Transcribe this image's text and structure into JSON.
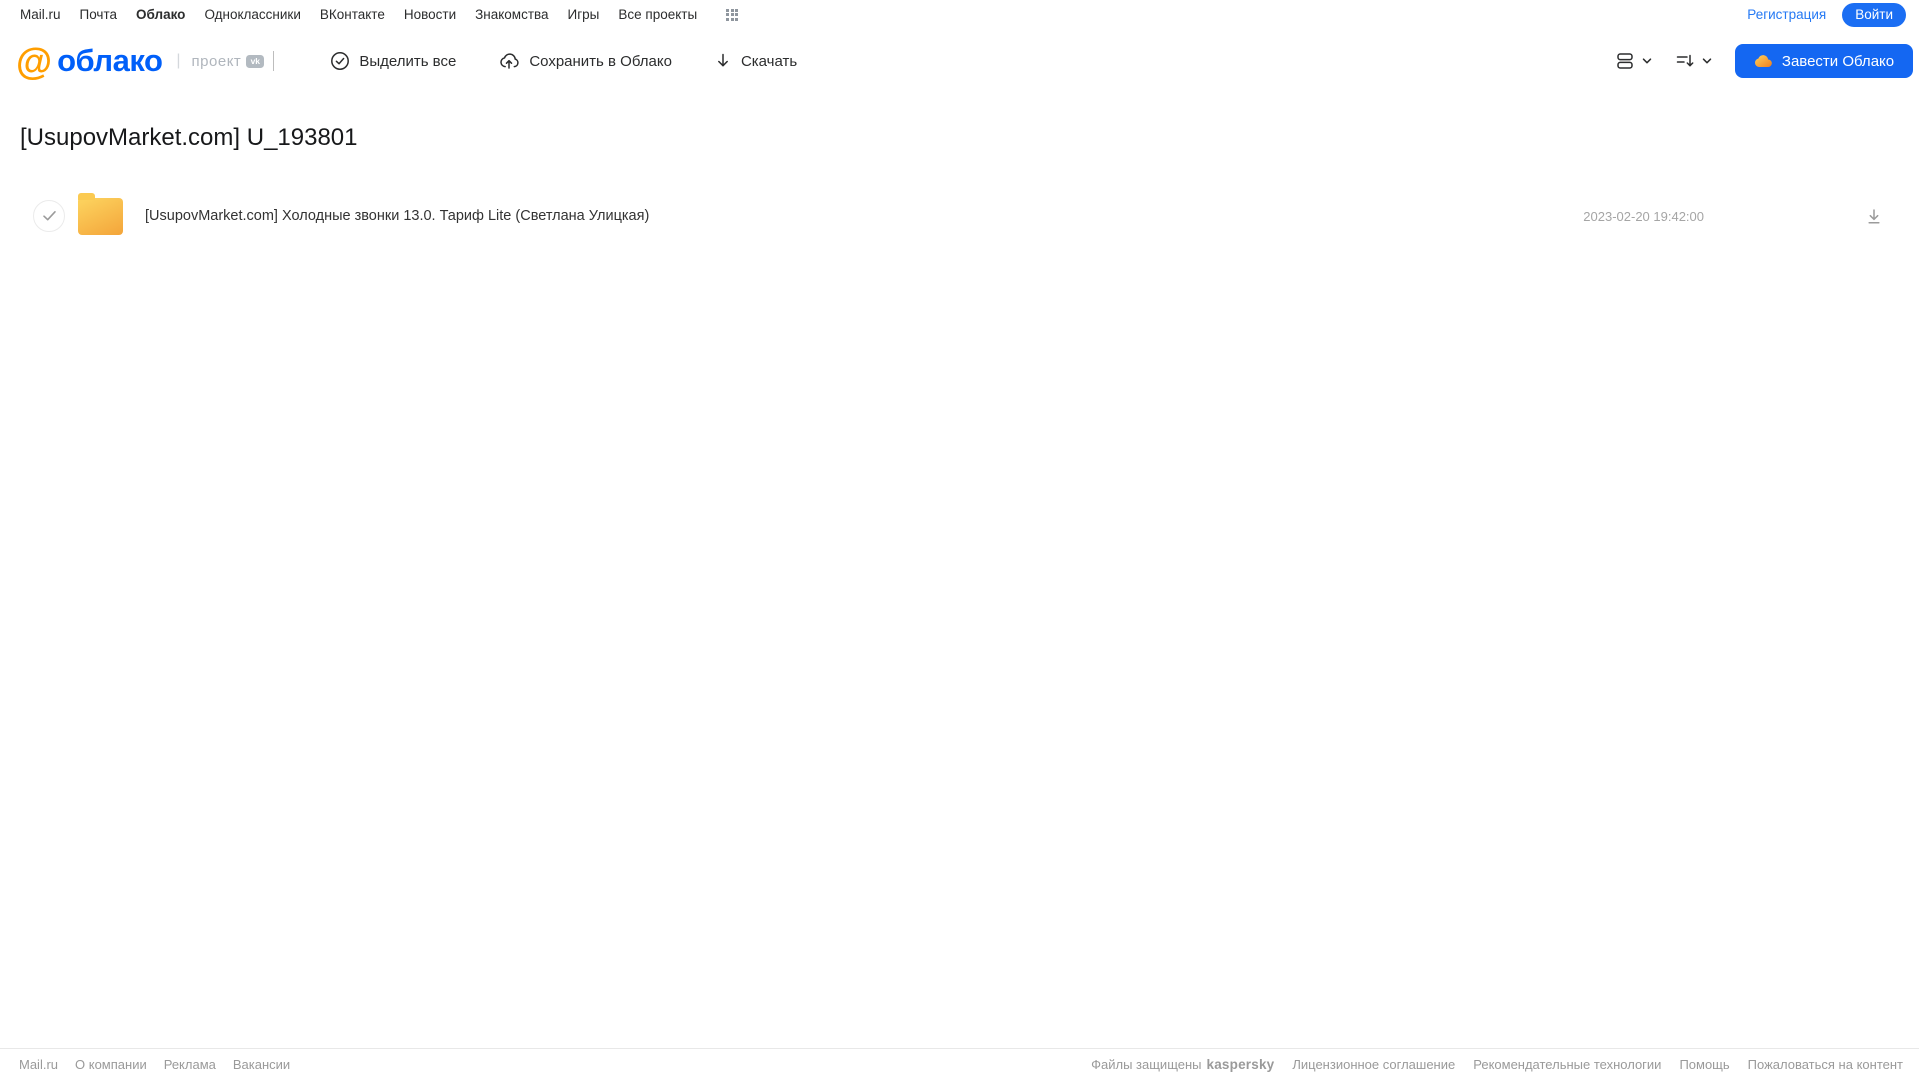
{
  "portal_nav": {
    "items": [
      "Mail.ru",
      "Почта",
      "Облако",
      "Одноклассники",
      "ВКонтакте",
      "Новости",
      "Знакомства",
      "Игры",
      "Все проекты"
    ],
    "active_item": "Облако",
    "registration_label": "Регистрация",
    "login_label": "Войти"
  },
  "header": {
    "logo_at": "@",
    "logo_text": "облако",
    "logo_separator": "|",
    "project_label": "проект",
    "vk_badge": "vk",
    "toolbar": {
      "select_all_label": "Выделить все",
      "save_to_cloud_label": "Сохранить в Облако",
      "download_label": "Скачать"
    },
    "get_cloud_button_label": "Завести Облако"
  },
  "page": {
    "title": "[UsupovMarket.com] U_193801"
  },
  "files": [
    {
      "type": "folder",
      "name": "[UsupovMarket.com] Холодные звонки 13.0. Тариф Lite (Светлана Улицкая)",
      "date": "2023-02-20 19:42:00"
    }
  ],
  "footer": {
    "left_links": [
      "Mail.ru",
      "О компании",
      "Реклама",
      "Вакансии"
    ],
    "protected_by_label": "Файлы защищены",
    "kaspersky_label": "kaspersky",
    "right_links": [
      "Лицензионное соглашение",
      "Рекомендательные технологии",
      "Помощь",
      "Пожаловаться на контент"
    ]
  },
  "icons": {
    "apps_grid": "3x3-grid",
    "select_all": "check-circle",
    "save_to_cloud": "cloud-upload-arrow",
    "download": "arrow-down",
    "view_mode": "list-rows",
    "sort": "lines-with-down-arrow",
    "chevron": "chevron-down",
    "cloud_button": "orange-cloud",
    "row_download": "arrow-down-tray",
    "row_checkbox": "checkmark"
  },
  "colors": {
    "accent_blue": "#1b6ef3",
    "logo_orange": "#ff9e00",
    "logo_blue": "#005ff9",
    "kaspersky_green": "#00846c",
    "folder_top": "#fcd05c",
    "folder_bottom": "#f4a73c",
    "muted_gray": "#9a9a9a"
  }
}
